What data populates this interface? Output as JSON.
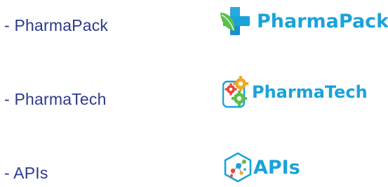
{
  "list": {
    "items": [
      {
        "label": "- PharmaPack"
      },
      {
        "label": "- PharmaTech"
      },
      {
        "label": "- APIs"
      }
    ]
  },
  "logos": {
    "pharmapack": {
      "name": "PharmaPack",
      "icon": "cross-leaf-icon"
    },
    "pharmatech": {
      "name": "PharmaTech",
      "icon": "gears-icon"
    },
    "apis": {
      "name": "APIs",
      "icon": "molecule-hexagon-icon"
    }
  },
  "colors": {
    "text": "#2c3a8c",
    "brand_blue": "#1aa3d9",
    "brand_green": "#5cbf4a",
    "brand_orange": "#f5a623",
    "brand_red": "#e2483d"
  }
}
